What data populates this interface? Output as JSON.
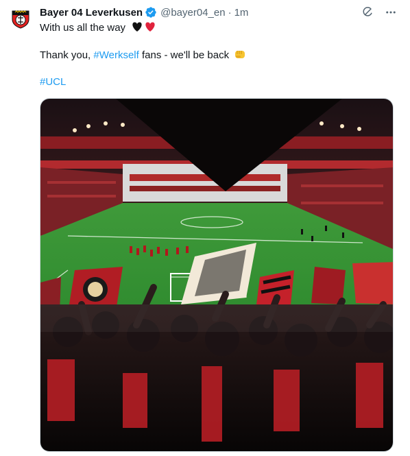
{
  "author": {
    "name": "Bayer 04 Leverkusen",
    "handle": "@bayer04_en",
    "separator": "·",
    "time": "1m"
  },
  "icons": {
    "verified": "verified-badge-icon",
    "grok": "grok-icon",
    "more": "more-icon",
    "hearts": "black-heart-red-heart-emoji",
    "fist": "oncoming-fist-emoji"
  },
  "tweet": {
    "line1": "With us all the way",
    "line2_prefix": "Thank you, ",
    "line2_hashtag": "#Werkself",
    "line2_suffix": " fans - we'll be back",
    "hashtag2": "#UCL"
  },
  "colors": {
    "accent": "#1d9bf0",
    "text": "#0f1419",
    "muted": "#536471",
    "club_red": "#e32221"
  }
}
